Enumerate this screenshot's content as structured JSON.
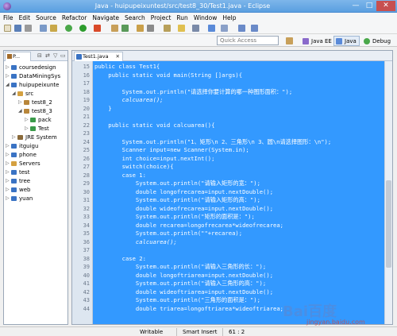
{
  "window": {
    "title": "Java - huipupeixuntest/src/test8_30/Test1.java - Eclipse",
    "controls": {
      "minimize": "—",
      "maximize": "□",
      "close": "✕"
    }
  },
  "menu": [
    "File",
    "Edit",
    "Source",
    "Refactor",
    "Navigate",
    "Search",
    "Project",
    "Run",
    "Window",
    "Help"
  ],
  "toolbar": {
    "icons": [
      "new-icon",
      "save-icon",
      "print-icon",
      "debug-icon",
      "run-icon",
      "search-icon",
      "package-icon",
      "navigate-icon"
    ]
  },
  "quick_access": {
    "placeholder": "Quick Access"
  },
  "perspectives": [
    {
      "label": "Java EE",
      "icon": "javaee-perspective-icon"
    },
    {
      "label": "Java",
      "icon": "java-perspective-icon",
      "active": true
    },
    {
      "label": "Debug",
      "icon": "debug-perspective-icon"
    }
  ],
  "package_explorer": {
    "tab_label": "P...",
    "tree": [
      {
        "label": "coursedesign",
        "arrow": "▷",
        "icon": "project"
      },
      {
        "label": "DataMiningSys",
        "arrow": "▷",
        "icon": "project"
      },
      {
        "label": "huipupeixunte",
        "arrow": "◢",
        "icon": "project"
      },
      {
        "label": "src",
        "arrow": "◢",
        "icon": "src-folder"
      },
      {
        "label": "test8_2",
        "arrow": "▷",
        "icon": "package"
      },
      {
        "label": "test8_3",
        "arrow": "◢",
        "icon": "package"
      },
      {
        "label": "pack",
        "arrow": "▷",
        "icon": "class"
      },
      {
        "label": "Test",
        "arrow": "▷",
        "icon": "class"
      },
      {
        "label": "JRE System",
        "arrow": "▷",
        "icon": "library"
      },
      {
        "label": "itguigu",
        "arrow": "▷",
        "icon": "project"
      },
      {
        "label": "phone",
        "arrow": "▷",
        "icon": "project"
      },
      {
        "label": "Servers",
        "arrow": "▷",
        "icon": "project"
      },
      {
        "label": "test",
        "arrow": "▷",
        "icon": "project"
      },
      {
        "label": "tree",
        "arrow": "▷",
        "icon": "project"
      },
      {
        "label": "web",
        "arrow": "▷",
        "icon": "project"
      },
      {
        "label": "yuan",
        "arrow": "▷",
        "icon": "project"
      }
    ]
  },
  "editor": {
    "tab_label": "Test1.java",
    "lines": [
      {
        "num": "15",
        "code": "public class Test1{"
      },
      {
        "num": "16",
        "code": "    public static void main(String []args){"
      },
      {
        "num": "17",
        "code": ""
      },
      {
        "num": "18",
        "code": "        System.out.println(\"请选择你要计算的哪一种图形面积：\");"
      },
      {
        "num": "19",
        "code": "        calcuarea();",
        "italic": true
      },
      {
        "num": "20",
        "code": "    }"
      },
      {
        "num": "21",
        "code": ""
      },
      {
        "num": "22",
        "code": "    public static void calcuarea(){"
      },
      {
        "num": "23",
        "code": ""
      },
      {
        "num": "24",
        "code": "        System.out.println(\"1、矩形\\n 2、三角形\\n 3、圆\\n请选择图形：\\n\");"
      },
      {
        "num": "25",
        "code": "        Scanner input=new Scanner(System.in);"
      },
      {
        "num": "26",
        "code": "        int choice=input.nextInt();"
      },
      {
        "num": "27",
        "code": "        switch(choice){"
      },
      {
        "num": "28",
        "code": "        case 1:"
      },
      {
        "num": "29",
        "code": "            System.out.println(\"请输入矩形的宽：\");"
      },
      {
        "num": "30",
        "code": "            double longofrecarea=input.nextDouble();"
      },
      {
        "num": "31",
        "code": "            System.out.println(\"请输入矩形的高：\");"
      },
      {
        "num": "32",
        "code": "            double wideofrecarea=input.nextDouble();"
      },
      {
        "num": "33",
        "code": "            System.out.println(\"矩形的面积是：\");"
      },
      {
        "num": "34",
        "code": "            double recarea=longofrecarea*wideofrecarea;"
      },
      {
        "num": "35",
        "code": "            System.out.println(\"\"+recarea);"
      },
      {
        "num": "36",
        "code": "            calcuarea();",
        "italic": true
      },
      {
        "num": "37",
        "code": ""
      },
      {
        "num": "38",
        "code": "        case 2:"
      },
      {
        "num": "39",
        "code": "            System.out.println(\"请输入三角形的长：\");"
      },
      {
        "num": "40",
        "code": "            double longoftriarea=input.nextDouble();"
      },
      {
        "num": "41",
        "code": "            System.out.println(\"请输入三角形的高：\");"
      },
      {
        "num": "42",
        "code": "            double wideoftriarea=input.nextDouble();"
      },
      {
        "num": "43",
        "code": "            System.out.println(\"三角形的面积是：\");"
      },
      {
        "num": "44",
        "code": "            double triarea=longoftriarea*wideoftriarea;"
      }
    ]
  },
  "status": {
    "writable": "Writable",
    "insert_mode": "Smart Insert",
    "position": "61 : 2"
  },
  "watermark": {
    "text": "Bai百度",
    "url": "jingyan.baidu.com"
  }
}
